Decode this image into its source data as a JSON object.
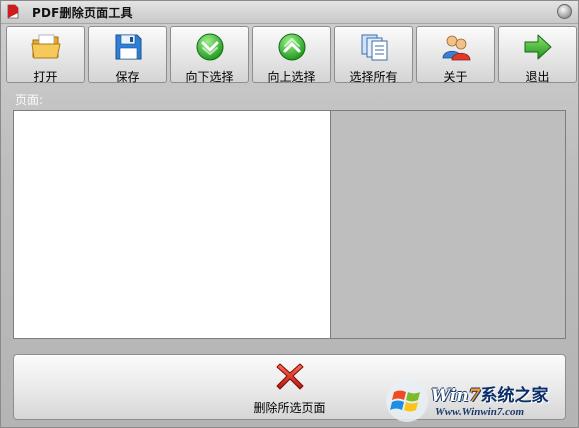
{
  "window": {
    "title": "PDF删除页面工具"
  },
  "toolbar": {
    "buttons": [
      {
        "label": "打开",
        "icon": "folder-icon"
      },
      {
        "label": "保存",
        "icon": "floppy-disk-icon"
      },
      {
        "label": "向下选择",
        "icon": "arrow-down-circle-icon"
      },
      {
        "label": "向上选择",
        "icon": "arrow-up-circle-icon"
      },
      {
        "label": "选择所有",
        "icon": "pages-stack-icon"
      },
      {
        "label": "关于",
        "icon": "users-icon"
      },
      {
        "label": "退出",
        "icon": "arrow-right-icon"
      }
    ]
  },
  "pages": {
    "label": "页面:"
  },
  "delete": {
    "label": "删除所选页面",
    "icon": "red-x-icon"
  },
  "watermark": {
    "brand_prefix": "Win",
    "brand_seven": "7",
    "brand_suffix": "系统之家",
    "url": "Www.Winwin7.com"
  },
  "colors": {
    "background": "#bdbdbd",
    "list_bg": "#ffffff",
    "preview_bg": "#bebebe",
    "delete_icon": "#d42a1e"
  }
}
